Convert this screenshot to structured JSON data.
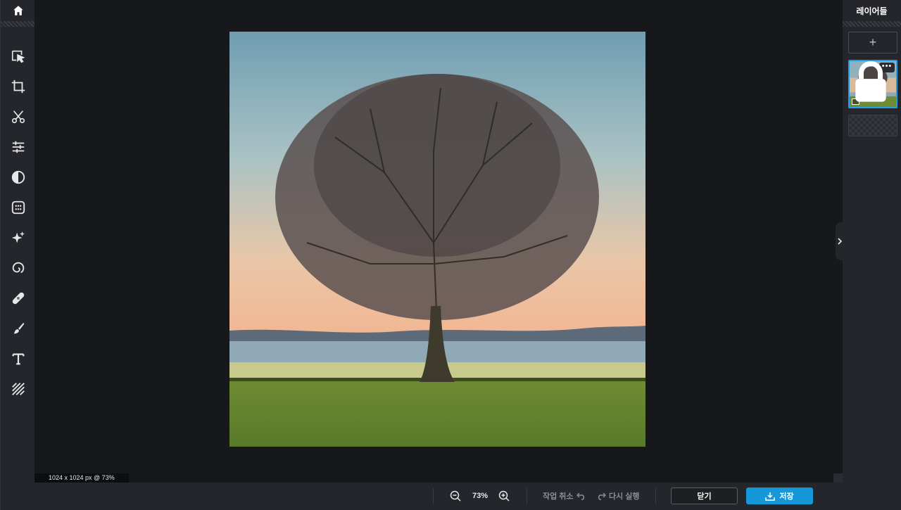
{
  "left_toolbar": {
    "home": {
      "icon": "home-icon"
    },
    "tools": [
      {
        "name": "arrange",
        "icon": "select-arrow-icon"
      },
      {
        "name": "crop",
        "icon": "crop-icon"
      },
      {
        "name": "cutout",
        "icon": "scissors-icon"
      },
      {
        "name": "adjust",
        "icon": "sliders-icon"
      },
      {
        "name": "effects",
        "icon": "contrast-icon"
      },
      {
        "name": "filter",
        "icon": "dots-grid-icon"
      },
      {
        "name": "retouch",
        "icon": "sparkle-icon"
      },
      {
        "name": "liquify",
        "icon": "spiral-icon"
      },
      {
        "name": "heal",
        "icon": "bandage-icon"
      },
      {
        "name": "draw",
        "icon": "brush-icon"
      },
      {
        "name": "text",
        "icon": "text-icon"
      },
      {
        "name": "pattern",
        "icon": "hatch-icon"
      }
    ]
  },
  "canvas": {
    "size_readout": "1024 x 1024 px @ 73%"
  },
  "layers_panel": {
    "title": "레이어들",
    "add_label": "+",
    "more_label": "•••"
  },
  "bottom_bar": {
    "zoom_level": "73%",
    "undo_label": "작업 취소",
    "redo_label": "다시 실행",
    "close_label": "닫기",
    "save_label": "저장"
  },
  "colors": {
    "accent": "#1597d8",
    "selection": "#1ea0e6",
    "panel_bg": "#24262b",
    "canvas_bg": "#17181c"
  }
}
